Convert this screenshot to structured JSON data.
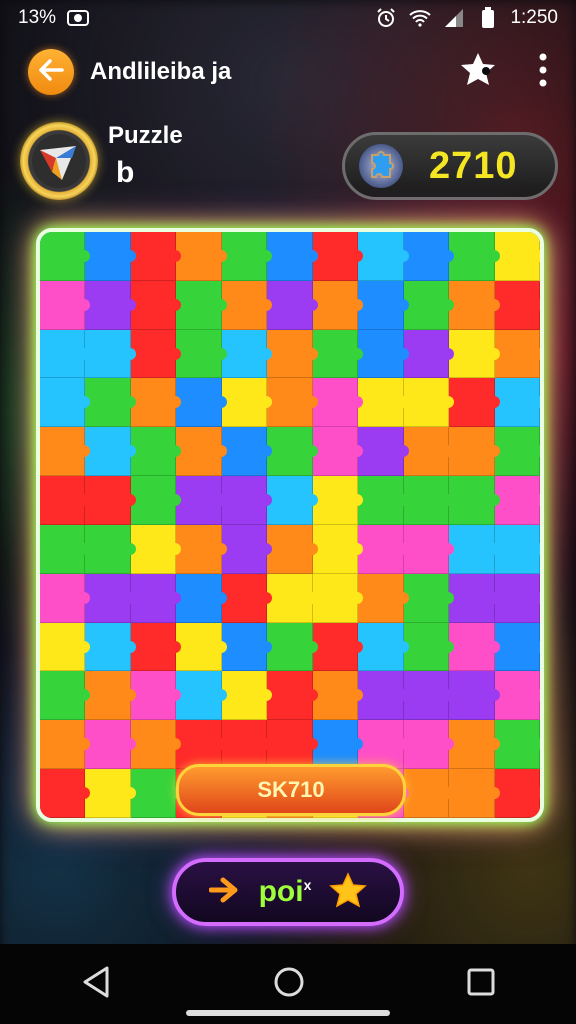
{
  "status": {
    "battery_pct": "13%",
    "time": "1:250"
  },
  "app": {
    "title": "Andlileiba ja"
  },
  "player": {
    "name": "Puzzle",
    "subtitle": "b"
  },
  "score": {
    "value": "2710"
  },
  "board": {
    "level_label": "SK710",
    "rows": 12,
    "cols": 11,
    "palette": [
      "#ff2a2a",
      "#ff8a1a",
      "#ffe81a",
      "#36d43a",
      "#1e8dff",
      "#9b3cf2",
      "#ff4fc8",
      "#25c4ff"
    ]
  },
  "play_button": {
    "label": "poi",
    "superscript": "x"
  },
  "icons": {
    "back": "arrow-left-icon",
    "favorite": "star-puzzle-icon",
    "menu": "more-vertical-icon",
    "gem": "puzzle-gem-icon"
  },
  "colors": {
    "score_text": "#f5e623",
    "play_label": "#9cff3a",
    "play_border": "#d36cff",
    "board_glow": "#7dff52"
  }
}
